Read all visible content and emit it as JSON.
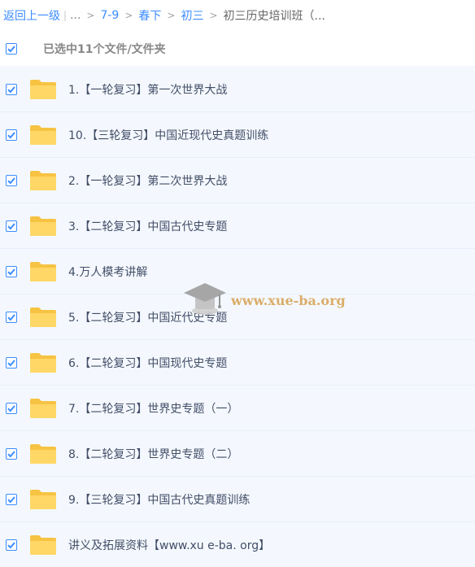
{
  "breadcrumb": {
    "back_label": "返回上一级",
    "ellipsis": "...",
    "items": [
      "7-9",
      "春下",
      "初三"
    ],
    "current": "初三历史培训班（..."
  },
  "selection": {
    "label": "已选中11个文件/文件夹"
  },
  "files": [
    {
      "name": "1.【一轮复习】第一次世界大战",
      "checked": true
    },
    {
      "name": "10.【三轮复习】中国近现代史真题训练",
      "checked": true
    },
    {
      "name": "2.【一轮复习】第二次世界大战",
      "checked": true
    },
    {
      "name": "3.【二轮复习】中国古代史专题",
      "checked": true
    },
    {
      "name": "4.万人模考讲解",
      "checked": true
    },
    {
      "name": "5.【二轮复习】中国近代史专题",
      "checked": true
    },
    {
      "name": "6.【二轮复习】中国现代史专题",
      "checked": true
    },
    {
      "name": "7.【二轮复习】世界史专题（一）",
      "checked": true
    },
    {
      "name": "8.【二轮复习】世界史专题（二）",
      "checked": true
    },
    {
      "name": "9.【三轮复习】中国古代史真题训练",
      "checked": true
    },
    {
      "name": "讲义及拓展资料【www.xu e-ba. org】",
      "checked": true
    }
  ],
  "watermark": {
    "text": "www.xue-ba.org"
  },
  "colors": {
    "accent": "#3b8cff",
    "folder": "#ffd766",
    "row_bg": "#f4f8fe",
    "text": "#424e67"
  }
}
